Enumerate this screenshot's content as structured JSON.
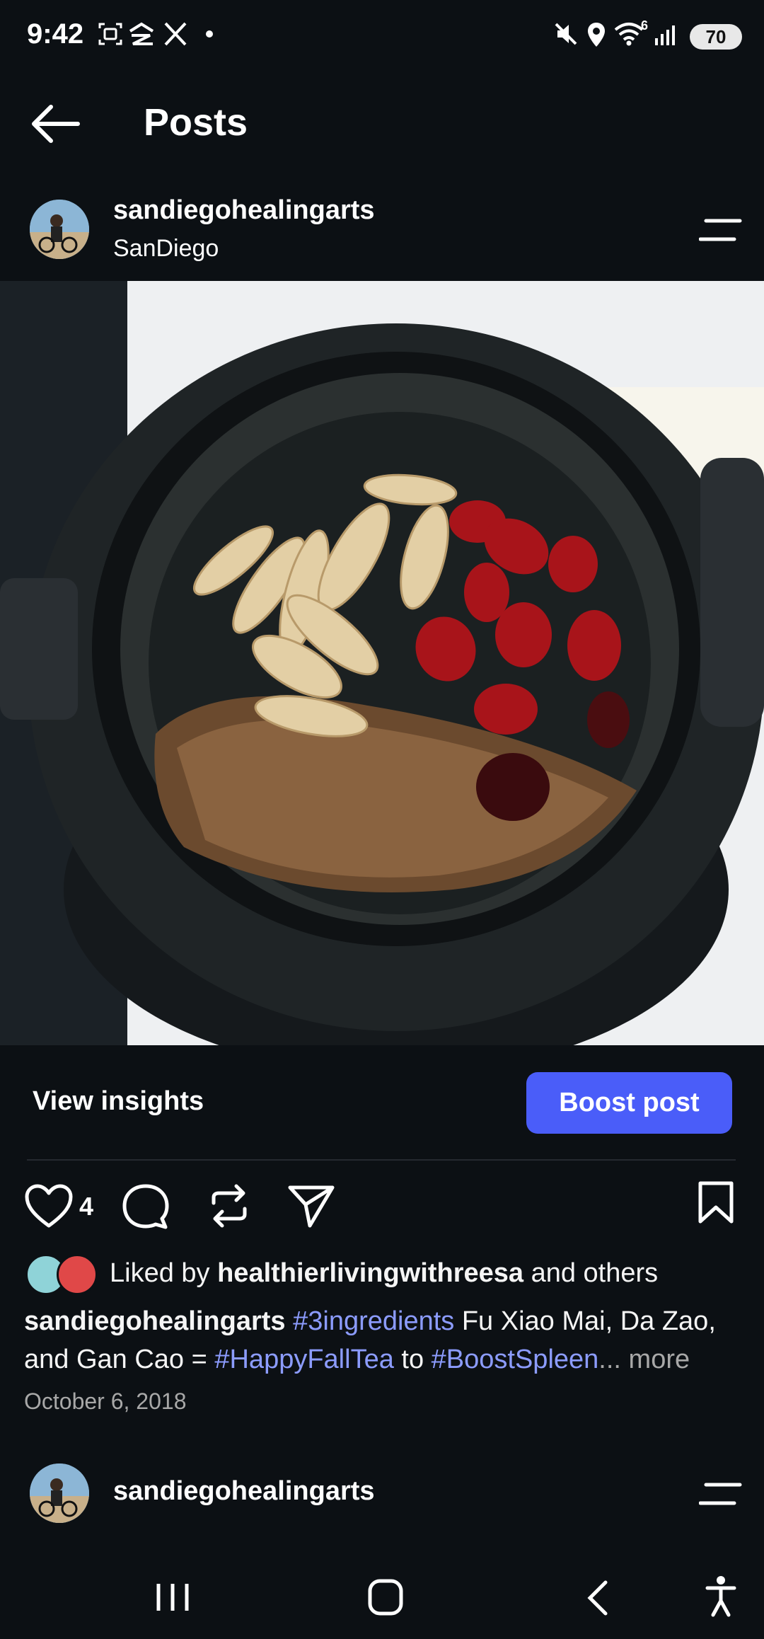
{
  "status_bar": {
    "time": "9:42",
    "battery": "70",
    "icons": [
      "screenshot-icon",
      "threads-notification-icon",
      "x-notification-icon",
      "dot-icon",
      "mute-icon",
      "location-icon",
      "wifi-icon",
      "signal-icon",
      "battery-icon"
    ],
    "wifi_badge": "6"
  },
  "header": {
    "title": "Posts"
  },
  "post": {
    "username": "sandiegohealingarts",
    "location": "SanDiego",
    "view_insights": "View insights",
    "boost_label": "Boost post",
    "like_count": "4",
    "liked_by_prefix": "Liked by ",
    "liked_by_user": "healthierlivingwithreesa",
    "liked_by_suffix": " and others",
    "caption": {
      "username": "sandiegohealingarts",
      "tag1": "#3ingredients",
      "text1": " Fu Xiao Mai, Da Zao,",
      "text2": "and Gan Cao = ",
      "tag2": "#HappyFallTea",
      "text3": " to ",
      "tag3": "#BoostSpleen",
      "ellipsis": "...",
      "more": " more"
    },
    "date": "October 6, 2018"
  },
  "next_post": {
    "username": "sandiegohealingarts"
  },
  "colors": {
    "background": "#0c1014",
    "accent": "#4a5df9",
    "hashtag": "#8c9cff"
  }
}
